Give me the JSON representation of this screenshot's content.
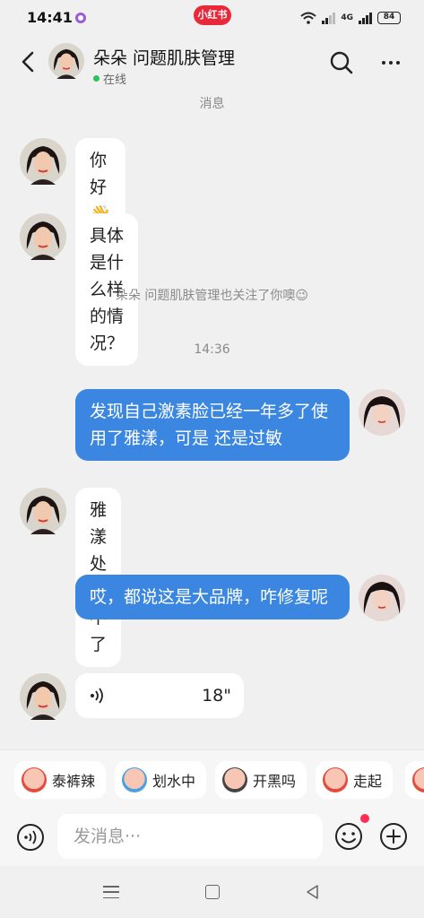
{
  "status_bar": {
    "time": "14:41",
    "app_badge": "小红书",
    "network": "4G",
    "battery": "84"
  },
  "header": {
    "contact_name": "朵朵 问题肌肤管理",
    "online_status": "在线"
  },
  "chat": {
    "top_system_note": "消息",
    "messages": [
      {
        "side": "in",
        "text": "你好👋"
      },
      {
        "side": "in",
        "text": "具体是什么样的情况？"
      },
      {
        "side": "system",
        "text": "朵朵 问题肌肤管理也关注了你噢😉"
      },
      {
        "side": "time",
        "text": "14:36"
      },
      {
        "side": "out",
        "text": "发现自己激素脸已经一年多了使用了雅漾，可是 还是过敏"
      },
      {
        "side": "in",
        "text": "雅漾处理不了"
      },
      {
        "side": "out",
        "text": "哎，都说这是大品牌，咋修复呢"
      },
      {
        "side": "in-voice",
        "text": "18\""
      }
    ]
  },
  "quick_replies": [
    {
      "label": "泰裤辣",
      "icon": "sticker-icon"
    },
    {
      "label": "划水中",
      "icon": "sticker-icon"
    },
    {
      "label": "开黑吗",
      "icon": "sticker-icon"
    },
    {
      "label": "走起",
      "icon": "sticker-icon"
    }
  ],
  "input": {
    "placeholder": "发消息···"
  },
  "colors": {
    "accent_blue": "#3a86e0",
    "online_green": "#2fc15f",
    "badge_red": "#e8293a"
  }
}
